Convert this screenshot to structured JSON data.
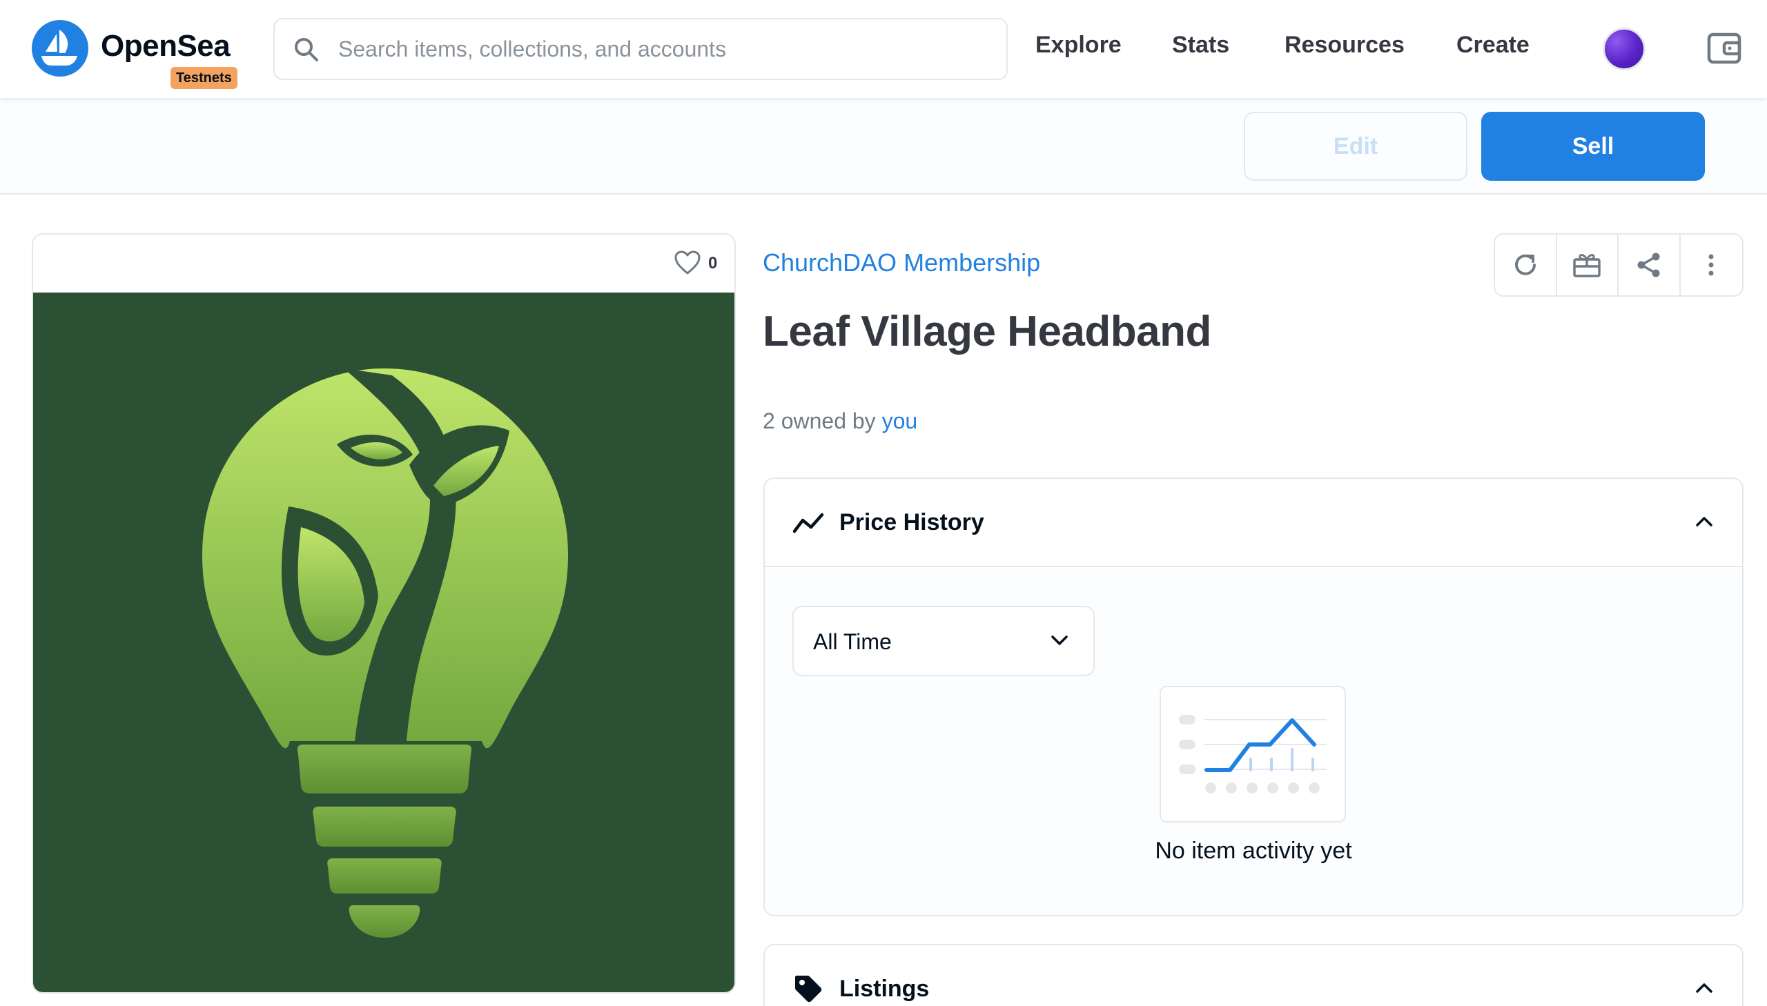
{
  "header": {
    "brand": "OpenSea",
    "badge": "Testnets",
    "search_placeholder": "Search items, collections, and accounts",
    "nav": [
      "Explore",
      "Stats",
      "Resources",
      "Create"
    ]
  },
  "action_bar": {
    "edit_label": "Edit",
    "sell_label": "Sell"
  },
  "item": {
    "favorites": "0",
    "collection": "ChurchDAO Membership",
    "title": "Leaf Village Headband",
    "owned_prefix": "2 owned by ",
    "owner": "you"
  },
  "price_history": {
    "title": "Price History",
    "period": "All Time",
    "empty_text": "No item activity yet"
  },
  "listings": {
    "title": "Listings"
  },
  "colors": {
    "accent": "#2081e2",
    "badge": "#f3a35d",
    "artwork_bg": "#2b5034"
  }
}
